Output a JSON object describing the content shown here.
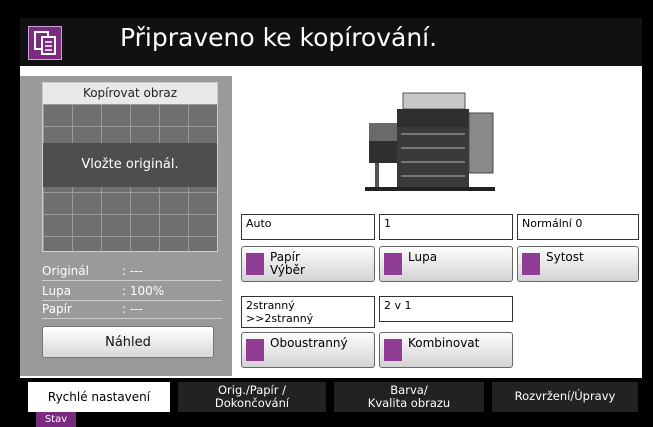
{
  "header": {
    "title": "Připraveno ke kopírování.",
    "icon": "copy-document-icon"
  },
  "preview": {
    "title": "Kopírovat obraz",
    "message": "Vložte originál.",
    "info": [
      {
        "key": "Originál",
        "value": ": ---"
      },
      {
        "key": "Lupa",
        "value": ": 100%"
      },
      {
        "key": "Papír",
        "value": ": ---"
      }
    ],
    "preview_button": "Náhled"
  },
  "functions": {
    "paper": {
      "value": "Auto",
      "label_line1": "Papír",
      "label_line2": "Výběr"
    },
    "zoom": {
      "value": "1",
      "label": "Lupa"
    },
    "density": {
      "value": "Normální 0",
      "label": "Sytost"
    },
    "duplex": {
      "value_line1": "2stranný",
      "value_line2": ">>2stranný",
      "label": "Oboustranný"
    },
    "combine": {
      "value": "2 v 1",
      "label": "Kombinovat"
    }
  },
  "tabs": [
    {
      "label": "Rychlé nastavení"
    },
    {
      "label_line1": "Orig./Papír /",
      "label_line2": "Dokončování"
    },
    {
      "label_line1": "Barva/",
      "label_line2": "Kvalita obrazu"
    },
    {
      "label": "Rozvržení/Úpravy"
    }
  ],
  "status": {
    "label": "Stav"
  },
  "colors": {
    "accent": "#7a2a7f",
    "header_bg": "#111111",
    "panel_bg": "#9a9a9a"
  }
}
